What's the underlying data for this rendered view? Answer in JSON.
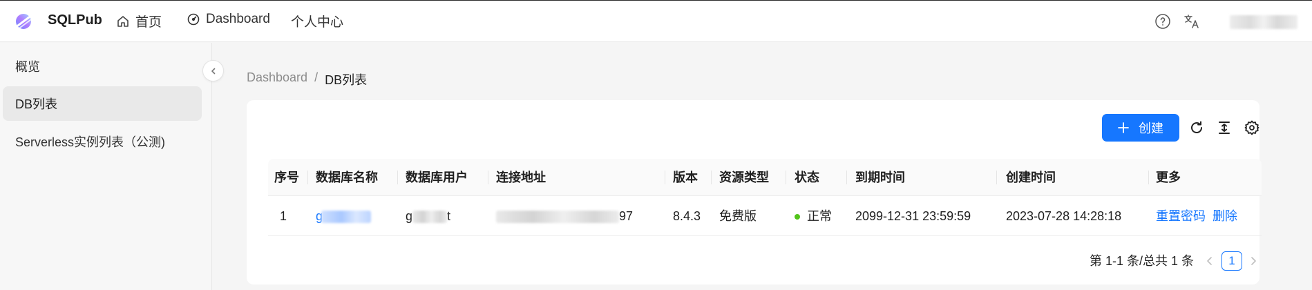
{
  "header": {
    "app_name": "SQLPub",
    "nav": [
      {
        "label": "首页",
        "icon": "home-icon"
      },
      {
        "label": "Dashboard",
        "icon": "dashboard-icon"
      },
      {
        "label": "个人中心"
      }
    ],
    "right_icons": [
      "help-icon",
      "translate-icon"
    ]
  },
  "sidebar": {
    "items": [
      {
        "label": "概览",
        "active": false
      },
      {
        "label": "DB列表",
        "active": true
      },
      {
        "label": "Serverless实例列表（公测)",
        "active": false
      }
    ]
  },
  "breadcrumb": {
    "parent": "Dashboard",
    "separator": "/",
    "current": "DB列表"
  },
  "toolbar": {
    "create_label": "创建",
    "icons": [
      "reload-icon",
      "density-icon",
      "settings-icon"
    ]
  },
  "table": {
    "columns": [
      "序号",
      "数据库名称",
      "数据库用户",
      "连接地址",
      "版本",
      "资源类型",
      "状态",
      "到期时间",
      "创建时间",
      "更多"
    ],
    "rows": [
      {
        "index": "1",
        "db_name_visible": "g",
        "db_user_prefix": "g",
        "db_user_suffix": "t",
        "address_suffix": "97",
        "version": "8.4.3",
        "resource_type": "免费版",
        "status": "正常",
        "expire_time": "2099-12-31 23:59:59",
        "create_time": "2023-07-28 14:28:18",
        "actions": [
          "重置密码",
          "删除"
        ]
      }
    ]
  },
  "pagination": {
    "summary": "第 1-1 条/总共 1 条",
    "current_page": "1"
  },
  "colors": {
    "primary": "#1677ff",
    "status_ok": "#52c41a"
  }
}
